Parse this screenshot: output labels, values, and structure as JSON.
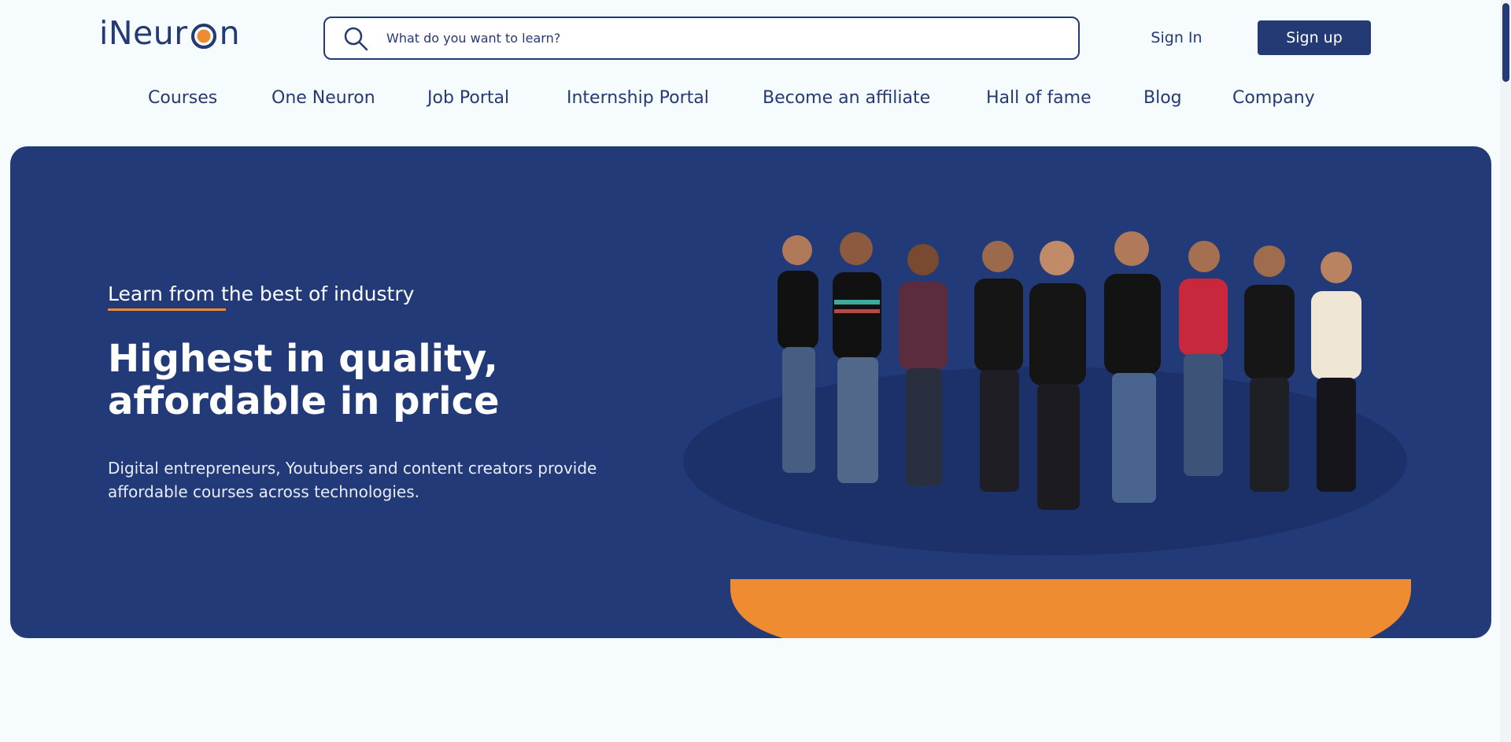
{
  "brand": {
    "logo_prefix": "iNeur",
    "logo_suffix": "n",
    "primary_color": "#233a75",
    "accent_color": "#ef8b30"
  },
  "search": {
    "placeholder": "What do you want to learn?",
    "icon": "search-icon"
  },
  "auth": {
    "sign_in": "Sign In",
    "sign_up": "Sign up"
  },
  "nav": {
    "items": [
      {
        "label": "Courses"
      },
      {
        "label": "One Neuron"
      },
      {
        "label": "Job Portal"
      },
      {
        "label": "Internship Portal"
      },
      {
        "label": "Become an affiliate"
      },
      {
        "label": "Hall of fame"
      },
      {
        "label": "Blog"
      },
      {
        "label": "Company"
      }
    ]
  },
  "hero": {
    "eyebrow": "Learn from the best of industry",
    "headline": "Highest in quality, affordable in price",
    "subtext": "Digital entrepreneurs, Youtubers and content creators provide affordable courses across technologies.",
    "background_color": "#233a79",
    "image": "team-photo"
  }
}
